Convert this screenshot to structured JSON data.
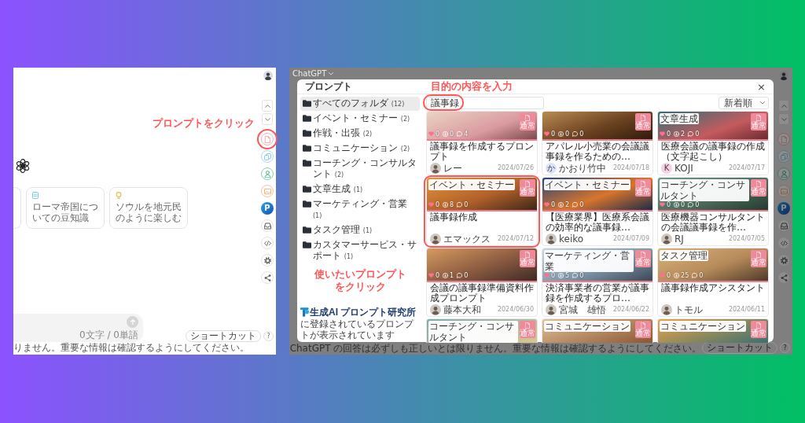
{
  "chat_page": {
    "side_tools": [
      {
        "kind": "up",
        "highlighted": false
      },
      {
        "kind": "down",
        "highlighted": false
      },
      {
        "kind": "prompt",
        "highlighted": true
      },
      {
        "kind": "copy",
        "highlighted": false
      },
      {
        "kind": "person",
        "highlighted": false
      },
      {
        "kind": "image",
        "highlighted": false
      },
      {
        "kind": "logo",
        "text": "P",
        "highlighted": false
      },
      {
        "kind": "tray",
        "highlighted": false
      },
      {
        "kind": "code",
        "highlighted": false
      },
      {
        "kind": "settings",
        "highlighted": false
      },
      {
        "kind": "share",
        "highlighted": false
      }
    ],
    "annotation": "プロンプトをクリック",
    "suggestions": [
      {
        "kind": "partial"
      },
      {
        "kind": "full",
        "text": "ローマ帝国についての豆知識"
      },
      {
        "kind": "full",
        "text": "ソウルを地元民のように楽しむ"
      }
    ],
    "composer": {
      "counter": "0文字 / 0単語"
    },
    "shortcut_button": "ショートカット",
    "help_button": "?",
    "disclaimer": "りません。重要な情報は確認するようにしてください。"
  },
  "dimmed_page": {
    "model_menu": "ChatGPT",
    "side_tools": [
      {
        "kind": "up"
      },
      {
        "kind": "down"
      },
      {
        "kind": "prompt"
      },
      {
        "kind": "copy"
      },
      {
        "kind": "person"
      },
      {
        "kind": "image"
      },
      {
        "kind": "logo",
        "text": "P"
      },
      {
        "kind": "tray"
      },
      {
        "kind": "code"
      },
      {
        "kind": "settings"
      },
      {
        "kind": "share"
      }
    ],
    "disclaimer": "ChatGPT の回答は必ずしも正しいとは限りません。重要な情報は確認するようにしてください。",
    "shortcut_button": "ショートカット",
    "help_button": "?"
  },
  "prompt_dialog": {
    "title": "プロンプト",
    "search_annotation": "目的の内容を入力",
    "close": "×",
    "folders": [
      {
        "label": "すべてのフォルダ",
        "count": "(12)",
        "selected": true
      },
      {
        "label": "イベント・セミナー",
        "count": "(2)",
        "selected": false
      },
      {
        "label": "作戦・出張",
        "count": "(2)",
        "selected": false
      },
      {
        "label": "コミュニケーション",
        "count": "(2)",
        "selected": false
      },
      {
        "label": "コーチング・コンサルタント",
        "count": "(2)",
        "selected": false
      },
      {
        "label": "文章生成",
        "count": "(1)",
        "selected": false
      },
      {
        "label": "マーケティング・営業",
        "count": "(1)",
        "selected": false
      },
      {
        "label": "タスク管理",
        "count": "(1)",
        "selected": false
      },
      {
        "label": "カスタマーサービス・サポート",
        "count": "(1)",
        "selected": false
      }
    ],
    "card_annotation": "使いたいプロンプトをクリック",
    "brand": "生成AI プロンプト研究所",
    "brand_note": "に登録されているプロンプトが表示されています",
    "search": {
      "value": "議事録",
      "highlighted": true
    },
    "sort": {
      "value": "新着順"
    },
    "cards": [
      {
        "badge": "通常",
        "stats": [
          "0",
          "0",
          "4"
        ],
        "title": "議事録を作成するプロンプト",
        "author": "レー",
        "avatar": {
          "kind": "photo"
        },
        "date": "2024/07/26",
        "highlighted": false
      },
      {
        "badge": "通常",
        "stats": [
          "0",
          "0",
          "0"
        ],
        "title": "アパレル小売業の会議議事録を作るための…",
        "author": "かおり竹中",
        "avatar": {
          "kind": "letter",
          "letter": "か",
          "color": "#dbe3fb"
        },
        "date": "2024/07/18",
        "highlighted": false
      },
      {
        "tag": "文章生成",
        "badge": "通常",
        "stats": [
          "0",
          "2",
          "0"
        ],
        "title": "医療会議の議事録の作成（文字起こし）",
        "author": "KOJI",
        "avatar": {
          "kind": "letter",
          "letter": "K",
          "color": "#f8d0e8"
        },
        "date": "2024/07/17",
        "highlighted": false
      },
      {
        "tag": "イベント・セミナー",
        "badge": "通常",
        "stats": [
          "0",
          "8",
          "0"
        ],
        "title": "議事録作成",
        "author": "エマックス",
        "avatar": {
          "kind": "photo"
        },
        "date": "2024/07/12",
        "highlighted": true
      },
      {
        "tag": "イベント・セミナー",
        "badge": "通常",
        "stats": [
          "0",
          "2",
          "0"
        ],
        "title": "【医療業界】医療系会議の効率的な議事録…",
        "author": "keiko",
        "avatar": {
          "kind": "photo"
        },
        "date": "2024/07/09",
        "highlighted": false
      },
      {
        "tag": "コーチング・コンサルタント",
        "badge": "通常",
        "stats": [
          "0",
          "0",
          "0"
        ],
        "title": "医療機器コンサルタントの会議議事録を作…",
        "author": "RJ",
        "avatar": {
          "kind": "photo"
        },
        "date": "2024/07/05",
        "highlighted": false
      },
      {
        "badge": "通常",
        "stats": [
          "0",
          "1",
          "0"
        ],
        "title": "会議の議事録準備資料作成プロンプト",
        "author": "藤本大和",
        "avatar": {
          "kind": "photo"
        },
        "date": "2024/06/30",
        "highlighted": false
      },
      {
        "tag": "マーケティング・営業",
        "badge": "通常",
        "stats": [
          "0",
          "5",
          "0"
        ],
        "title": "決済事業者の営業が議事録を作成するプロ…",
        "author": "宮城　雄悟",
        "avatar": {
          "kind": "photo"
        },
        "date": "2024/06/22",
        "highlighted": false
      },
      {
        "tag": "タスク管理",
        "badge": "通常",
        "stats": [
          "0",
          "25",
          "0"
        ],
        "title": "議事録作成アシスタント",
        "author": "トモル",
        "avatar": {
          "kind": "photo"
        },
        "date": "2024/06/11",
        "highlighted": false
      },
      {
        "tag": "コーチング・コンサルタント",
        "badge": "通常",
        "highlighted": false
      },
      {
        "tag": "コミュニケーション",
        "badge": "通常",
        "highlighted": false
      },
      {
        "tag": "コミュニケーション",
        "badge": "通常",
        "highlighted": false
      }
    ]
  }
}
